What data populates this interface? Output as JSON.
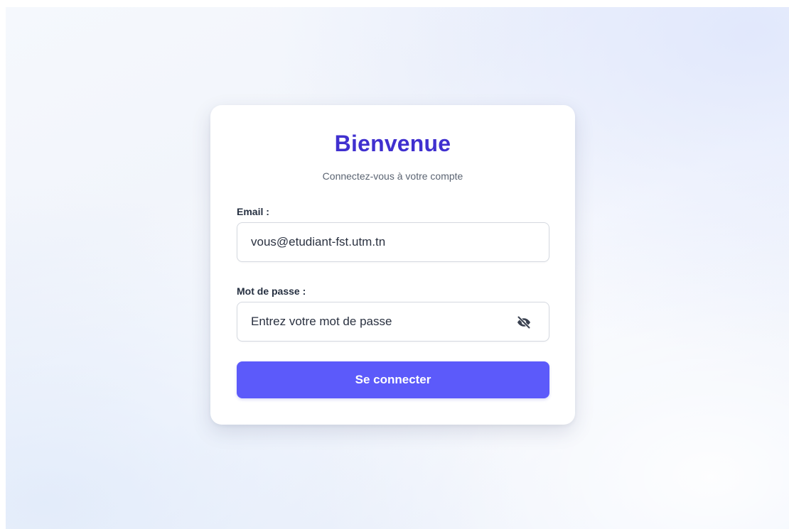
{
  "login": {
    "title": "Bienvenue",
    "subtitle": "Connectez-vous à votre compte",
    "email_label": "Email :",
    "email_value": "vous@etudiant-fst.utm.tn",
    "password_label": "Mot de passe :",
    "password_placeholder": "Entrez votre mot de passe",
    "password_toggle_icon": "eye-slash-icon",
    "submit_label": "Se connecter"
  },
  "colors": {
    "accent": "#4030cf",
    "button": "#5c5afa"
  }
}
